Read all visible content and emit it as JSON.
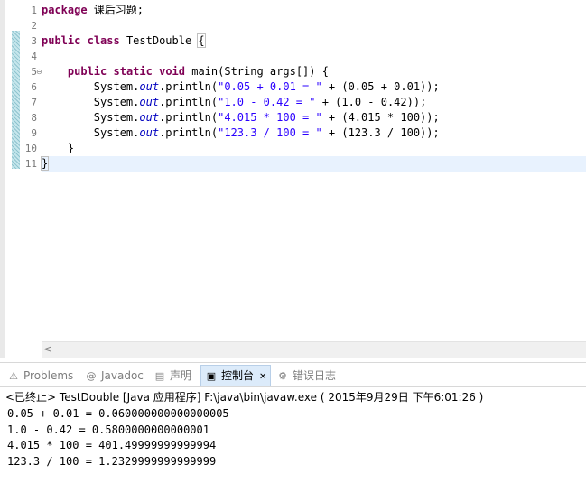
{
  "editor": {
    "line_numbers": [
      "1",
      "2",
      "3",
      "4",
      "5",
      "6",
      "7",
      "8",
      "9",
      "10",
      "11"
    ],
    "lines": [
      [
        {
          "t": "kw",
          "v": "package"
        },
        {
          "t": "",
          "v": " 课后习题;"
        }
      ],
      [],
      [
        {
          "t": "kw",
          "v": "public"
        },
        {
          "t": "",
          "v": " "
        },
        {
          "t": "kw",
          "v": "class"
        },
        {
          "t": "",
          "v": " TestDouble "
        },
        {
          "t": "hl",
          "v": "{"
        }
      ],
      [],
      [
        {
          "t": "",
          "v": "    "
        },
        {
          "t": "kw",
          "v": "public"
        },
        {
          "t": "",
          "v": " "
        },
        {
          "t": "kw",
          "v": "static"
        },
        {
          "t": "",
          "v": " "
        },
        {
          "t": "kw",
          "v": "void"
        },
        {
          "t": "",
          "v": " main(String args[]) {"
        }
      ],
      [
        {
          "t": "",
          "v": "        System."
        },
        {
          "t": "fld",
          "v": "out"
        },
        {
          "t": "",
          "v": ".println("
        },
        {
          "t": "str",
          "v": "\"0.05 + 0.01 = \""
        },
        {
          "t": "",
          "v": " + (0.05 + 0.01));"
        }
      ],
      [
        {
          "t": "",
          "v": "        System."
        },
        {
          "t": "fld",
          "v": "out"
        },
        {
          "t": "",
          "v": ".println("
        },
        {
          "t": "str",
          "v": "\"1.0 - 0.42 = \""
        },
        {
          "t": "",
          "v": " + (1.0 - 0.42));"
        }
      ],
      [
        {
          "t": "",
          "v": "        System."
        },
        {
          "t": "fld",
          "v": "out"
        },
        {
          "t": "",
          "v": ".println("
        },
        {
          "t": "str",
          "v": "\"4.015 * 100 = \""
        },
        {
          "t": "",
          "v": " + (4.015 * 100));"
        }
      ],
      [
        {
          "t": "",
          "v": "        System."
        },
        {
          "t": "fld",
          "v": "out"
        },
        {
          "t": "",
          "v": ".println("
        },
        {
          "t": "str",
          "v": "\"123.3 / 100 = \""
        },
        {
          "t": "",
          "v": " + (123.3 / 100));"
        }
      ],
      [
        {
          "t": "",
          "v": "    }"
        }
      ],
      [
        {
          "t": "hl",
          "v": "}"
        }
      ]
    ]
  },
  "tabs": [
    {
      "icon": "problems-icon",
      "glyph": "⚠",
      "label": "Problems"
    },
    {
      "icon": "javadoc-icon",
      "glyph": "@",
      "label": "Javadoc"
    },
    {
      "icon": "declaration-icon",
      "glyph": "▤",
      "label": "声明"
    },
    {
      "icon": "console-icon",
      "glyph": "▣",
      "label": "控制台",
      "close": "✕"
    },
    {
      "icon": "error-log-icon",
      "glyph": "⚙",
      "label": "错误日志"
    }
  ],
  "console": {
    "header": "<已终止> TestDouble [Java 应用程序] F:\\java\\bin\\javaw.exe ( 2015年9月29日 下午6:01:26 )",
    "output": [
      "0.05 + 0.01 = 0.060000000000000005",
      "1.0 - 0.42 = 0.5800000000000001",
      "4.015 * 100 = 401.49999999999994",
      "123.3 / 100 = 1.2329999999999999"
    ]
  },
  "scroll_left_glyph": "<"
}
